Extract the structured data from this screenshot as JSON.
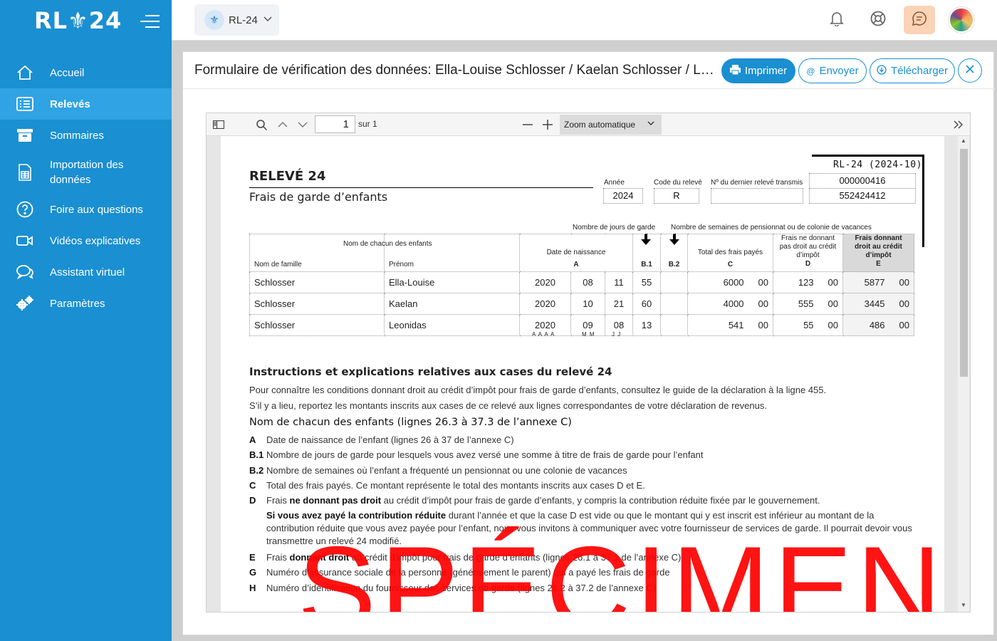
{
  "app": {
    "logo_text": "RL⚜24",
    "brand_color": "#1a8fd1"
  },
  "sidebar": {
    "items": [
      {
        "label": "Accueil",
        "icon": "home-icon",
        "active": false
      },
      {
        "label": "Relevés",
        "icon": "list-icon",
        "active": true
      },
      {
        "label": "Sommaires",
        "icon": "archive-icon",
        "active": false
      },
      {
        "label": "Importation des données",
        "icon": "spreadsheet-icon",
        "active": false
      },
      {
        "label": "Foire aux questions",
        "icon": "question-icon",
        "active": false
      },
      {
        "label": "Vidéos explicatives",
        "icon": "video-icon",
        "active": false
      },
      {
        "label": "Assistant virtuel",
        "icon": "chat-icon",
        "active": false
      },
      {
        "label": "Paramètres",
        "icon": "gear-icon",
        "active": false
      }
    ]
  },
  "topbar": {
    "selector_label": "RL-24"
  },
  "modal": {
    "title": "Formulaire de vérification des données: Ella-Louise Schlosser / Kaelan Schlosser / Leonidas Schlosser",
    "print_label": "Imprimer",
    "send_label": "Envoyer",
    "download_label": "Télécharger"
  },
  "pdf_toolbar": {
    "page_current": "1",
    "page_total": "sur 1",
    "zoom_label": "Zoom automatique"
  },
  "form": {
    "rl_code": "RL-24 (2024-10)",
    "title": "RELEVÉ 24",
    "subtitle": "Frais de garde d’enfants",
    "annee_label": "Année",
    "annee": "2024",
    "code_label": "Code du relevé",
    "code": "R",
    "dernier_label": "Nº du dernier relevé transmis",
    "no_releve": "000000416",
    "no_dernier": "552424412",
    "jours_label": "Nombre de jours de garde",
    "semaines_label": "Nombre de semaines de pensionnat ou de colonie de vacances",
    "col_enfants": "Nom de chacun des enfants",
    "col_nom": "Nom de famille",
    "col_prenom": "Prénom",
    "col_date": "Date de naissance",
    "col_date_code": "A",
    "col_b1": "B.1",
    "col_b2": "B.2",
    "col_c": "Total des frais payés",
    "col_c_code": "C",
    "col_d": "Frais ne donnant pas droit au crédit d’impôt",
    "col_d_code": "D",
    "col_e": "Frais donnant droit au crédit d’impôt",
    "col_e_code": "E",
    "date_hint_y": "A A A A",
    "date_hint_m": "M M",
    "date_hint_d": "J J",
    "rows": [
      {
        "nom": "Schlosser",
        "prenom": "Ella-Louise",
        "annee": "2020",
        "mois": "08",
        "jour": "11",
        "b1": "55",
        "b2": "",
        "c": "6000",
        "c_cents": "00",
        "d": "123",
        "d_cents": "00",
        "e": "5877",
        "e_cents": "00"
      },
      {
        "nom": "Schlosser",
        "prenom": "Kaelan",
        "annee": "2020",
        "mois": "10",
        "jour": "21",
        "b1": "60",
        "b2": "",
        "c": "4000",
        "c_cents": "00",
        "d": "555",
        "d_cents": "00",
        "e": "3445",
        "e_cents": "00"
      },
      {
        "nom": "Schlosser",
        "prenom": "Leonidas",
        "annee": "2020",
        "mois": "09",
        "jour": "08",
        "b1": "13",
        "b2": "",
        "c": "541",
        "c_cents": "00",
        "d": "55",
        "d_cents": "00",
        "e": "486",
        "e_cents": "00"
      }
    ],
    "instructions_title": "Instructions et explications relatives aux cases du relevé 24",
    "para1": "Pour connaître les conditions donnant droit au crédit d’impôt pour frais de garde d’enfants, consultez le guide de la déclaration à la ligne 455.",
    "para2": "S’il y a lieu, reportez les montants inscrits aux cases de ce relevé aux lignes correspondantes de votre déclaration de revenus.",
    "section_title": "Nom de chacun des enfants (lignes 26.3 à 37.3 de l’annexe C)",
    "items": [
      {
        "key": "A",
        "text": "Date de naissance de l’enfant (lignes 26 à 37 de l’annexe C)"
      },
      {
        "key": "B.1",
        "text": "Nombre de jours de garde pour lesquels vous avez versé une somme à titre de frais de garde pour l’enfant"
      },
      {
        "key": "B.2",
        "text": "Nombre de semaines où l’enfant a fréquenté un pensionnat ou une colonie de vacances"
      },
      {
        "key": "C",
        "text": "Total des frais payés. Ce montant représente le total des montants inscrits aux cases D et E."
      },
      {
        "key": "D",
        "pre": "Frais ",
        "bold": "ne donnant pas droit",
        "text": " au crédit d’impôt pour frais de garde d’enfants, y compris la contribution réduite fixée par le gouvernement."
      },
      {
        "key": "E",
        "pre": "Frais ",
        "bold": "donnant droit",
        "text": " au crédit d’impôt pour frais de garde d’enfants (lignes 26.1 à 37.1 de l’annexe C)"
      },
      {
        "key": "G",
        "text": "Numéro d’assurance sociale de la personne (généralement le parent) qui a payé les frais de garde"
      },
      {
        "key": "H",
        "text": "Numéro d’identification du fournisseur des services de garde (lignes 26.2 à 37.2 de l’annexe C)"
      }
    ],
    "d_note_bold": "Si vous avez payé la contribution réduite",
    "d_note_text": " durant l’année et que la case D est vide ou que le montant qui y est inscrit est inférieur au montant de la contribution réduite que vous avez payée pour l’enfant, nous vous invitons à communiquer avec votre fournisseur de services de garde. Il pourrait devoir vous transmettre un relevé 24 modifié."
  },
  "watermark": "SPÉCIMEN"
}
